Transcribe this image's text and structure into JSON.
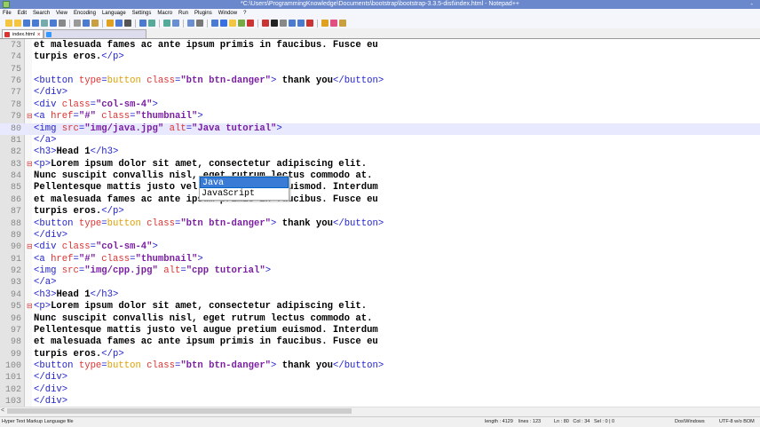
{
  "window": {
    "title": "*C:\\Users\\ProgrammingKnowledge\\Documents\\bootstrap\\bootstrap-3.3.5-dist\\index.html - Notepad++",
    "minimize": "-"
  },
  "menu": [
    "File",
    "Edit",
    "Search",
    "View",
    "Encoding",
    "Language",
    "Settings",
    "Macro",
    "Run",
    "Plugins",
    "Window",
    "?"
  ],
  "toolbar_colors": [
    "#f4c542",
    "#f4c542",
    "#4a7bd0",
    "#4a7bd0",
    "#7aa",
    "#4a7bd0",
    "#888",
    "#999",
    "#4a7bd0",
    "#c8a040",
    "#e0a020",
    "#4a7bd0",
    "#555",
    "#4a7bd0",
    "#5a9",
    "#5a9",
    "#6a8fd0",
    "#6a8fd0",
    "#777",
    "#4a7bd0",
    "#3a6fe0",
    "#f4c542",
    "#7a4",
    "#c33",
    "#c33",
    "#222",
    "#888",
    "#4a7bd0",
    "#4a7bd0",
    "#c33",
    "#e0a020",
    "#e05080",
    "#c8a040"
  ],
  "tabs": [
    {
      "label": "index.html",
      "close": "x"
    },
    {
      "label": "",
      "close": "x"
    }
  ],
  "editor": {
    "current_line": 80,
    "lines": [
      {
        "n": "73",
        "f": "",
        "c": [
          [
            "x",
            "et malesuada fames ac ante ipsum primis in faucibus. Fusce eu"
          ]
        ]
      },
      {
        "n": "74",
        "f": "",
        "c": [
          [
            "x",
            "turpis eros."
          ],
          [
            "t",
            "</p>"
          ]
        ]
      },
      {
        "n": "75",
        "f": "",
        "c": []
      },
      {
        "n": "76",
        "f": "",
        "c": [
          [
            "t",
            "<button "
          ],
          [
            "a",
            "type"
          ],
          [
            "t",
            "="
          ],
          [
            "u",
            "button"
          ],
          [
            "a",
            " class"
          ],
          [
            "t",
            "="
          ],
          [
            "v",
            "\"btn btn-danger\""
          ],
          [
            "t",
            ">"
          ],
          [
            "x",
            " thank you"
          ],
          [
            "t",
            "</button>"
          ]
        ]
      },
      {
        "n": "77",
        "f": "",
        "c": [
          [
            "t",
            "</div>"
          ]
        ]
      },
      {
        "n": "78",
        "f": "",
        "c": [
          [
            "t",
            "<div "
          ],
          [
            "a",
            "class"
          ],
          [
            "t",
            "="
          ],
          [
            "v",
            "\"col-sm-4\""
          ],
          [
            "t",
            ">"
          ]
        ]
      },
      {
        "n": "79",
        "f": "⊟",
        "c": [
          [
            "t",
            "<a "
          ],
          [
            "a",
            "href"
          ],
          [
            "t",
            "="
          ],
          [
            "v",
            "\"#\""
          ],
          [
            "a",
            " class"
          ],
          [
            "t",
            "="
          ],
          [
            "v",
            "\"thumbnail\""
          ],
          [
            "t",
            ">"
          ]
        ]
      },
      {
        "n": "80",
        "f": "",
        "c": [
          [
            "t",
            "<img "
          ],
          [
            "a",
            "src"
          ],
          [
            "t",
            "="
          ],
          [
            "v",
            "\"img/java.jpg\""
          ],
          [
            "a",
            " alt"
          ],
          [
            "t",
            "="
          ],
          [
            "v",
            "\"Java tutorial\""
          ],
          [
            "t",
            ">"
          ]
        ]
      },
      {
        "n": "81",
        "f": "",
        "c": [
          [
            "t",
            "</a>"
          ]
        ]
      },
      {
        "n": "82",
        "f": "",
        "c": [
          [
            "t",
            "<h3>"
          ],
          [
            "x",
            "Head 1"
          ],
          [
            "t",
            "</h3>"
          ]
        ]
      },
      {
        "n": "83",
        "f": "⊟",
        "c": [
          [
            "t",
            "<p>"
          ],
          [
            "x",
            "Lorem ipsum dolor sit amet, consectetur adipiscing elit."
          ]
        ]
      },
      {
        "n": "84",
        "f": "",
        "c": [
          [
            "x",
            "Nunc suscipit convallis nisl, eget rutrum lectus commodo at."
          ]
        ]
      },
      {
        "n": "85",
        "f": "",
        "c": [
          [
            "x",
            "Pellentesque mattis justo vel augue pretium euismod. Interdum"
          ]
        ]
      },
      {
        "n": "86",
        "f": "",
        "c": [
          [
            "x",
            "et malesuada fames ac ante ipsum primis in faucibus. Fusce eu"
          ]
        ]
      },
      {
        "n": "87",
        "f": "",
        "c": [
          [
            "x",
            "turpis eros."
          ],
          [
            "t",
            "</p>"
          ]
        ]
      },
      {
        "n": "88",
        "f": "",
        "c": [
          [
            "t",
            "<button "
          ],
          [
            "a",
            "type"
          ],
          [
            "t",
            "="
          ],
          [
            "u",
            "button"
          ],
          [
            "a",
            " class"
          ],
          [
            "t",
            "="
          ],
          [
            "v",
            "\"btn btn-danger\""
          ],
          [
            "t",
            ">"
          ],
          [
            "x",
            " thank you"
          ],
          [
            "t",
            "</button>"
          ]
        ]
      },
      {
        "n": "89",
        "f": "",
        "c": [
          [
            "t",
            "</div>"
          ]
        ]
      },
      {
        "n": "90",
        "f": "⊟",
        "c": [
          [
            "t",
            "<div "
          ],
          [
            "a",
            "class"
          ],
          [
            "t",
            "="
          ],
          [
            "v",
            "\"col-sm-4\""
          ],
          [
            "t",
            ">"
          ]
        ]
      },
      {
        "n": "91",
        "f": "",
        "c": [
          [
            "t",
            "<a "
          ],
          [
            "a",
            "href"
          ],
          [
            "t",
            "="
          ],
          [
            "v",
            "\"#\""
          ],
          [
            "a",
            " class"
          ],
          [
            "t",
            "="
          ],
          [
            "v",
            "\"thumbnail\""
          ],
          [
            "t",
            ">"
          ]
        ]
      },
      {
        "n": "92",
        "f": "",
        "c": [
          [
            "t",
            "<img "
          ],
          [
            "a",
            "src"
          ],
          [
            "t",
            "="
          ],
          [
            "v",
            "\"img/cpp.jpg\""
          ],
          [
            "a",
            " alt"
          ],
          [
            "t",
            "="
          ],
          [
            "v",
            "\"cpp tutorial\""
          ],
          [
            "t",
            ">"
          ]
        ]
      },
      {
        "n": "93",
        "f": "",
        "c": [
          [
            "t",
            "</a>"
          ]
        ]
      },
      {
        "n": "94",
        "f": "",
        "c": [
          [
            "t",
            "<h3>"
          ],
          [
            "x",
            "Head 1"
          ],
          [
            "t",
            "</h3>"
          ]
        ]
      },
      {
        "n": "95",
        "f": "⊟",
        "c": [
          [
            "t",
            "<p>"
          ],
          [
            "x",
            "Lorem ipsum dolor sit amet, consectetur adipiscing elit."
          ]
        ]
      },
      {
        "n": "96",
        "f": "",
        "c": [
          [
            "x",
            "Nunc suscipit convallis nisl, eget rutrum lectus commodo at."
          ]
        ]
      },
      {
        "n": "97",
        "f": "",
        "c": [
          [
            "x",
            "Pellentesque mattis justo vel augue pretium euismod. Interdum"
          ]
        ]
      },
      {
        "n": "98",
        "f": "",
        "c": [
          [
            "x",
            "et malesuada fames ac ante ipsum primis in faucibus. Fusce eu"
          ]
        ]
      },
      {
        "n": "99",
        "f": "",
        "c": [
          [
            "x",
            "turpis eros."
          ],
          [
            "t",
            "</p>"
          ]
        ]
      },
      {
        "n": "100",
        "f": "",
        "c": [
          [
            "t",
            "<button "
          ],
          [
            "a",
            "type"
          ],
          [
            "t",
            "="
          ],
          [
            "u",
            "button"
          ],
          [
            "a",
            " class"
          ],
          [
            "t",
            "="
          ],
          [
            "v",
            "\"btn btn-danger\""
          ],
          [
            "t",
            ">"
          ],
          [
            "x",
            " thank you"
          ],
          [
            "t",
            "</button>"
          ]
        ]
      },
      {
        "n": "101",
        "f": "",
        "c": [
          [
            "t",
            "</div>"
          ]
        ]
      },
      {
        "n": "102",
        "f": "",
        "c": [
          [
            "t",
            "</div>"
          ]
        ]
      },
      {
        "n": "103",
        "f": "",
        "c": [
          [
            "t",
            "</div>"
          ]
        ]
      }
    ]
  },
  "autocomplete": {
    "items": [
      "Java",
      "JavaScript"
    ],
    "selected": 0
  },
  "hscroll": {
    "arrow": "<"
  },
  "status": {
    "file_type": "Hyper Text Markup Language file",
    "length": "length : 4129",
    "lines": "lines : 123",
    "position": "Ln : 80   Col : 34   Sel : 0 | 0",
    "eol": "Dos\\Windows",
    "encoding": "UTF-8 w/o BOM"
  }
}
